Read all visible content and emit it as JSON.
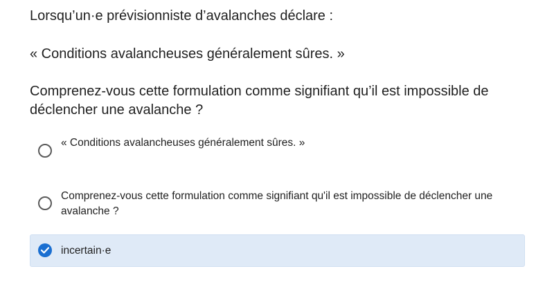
{
  "question": {
    "intro": "Lorsqu’un·e prévisionniste d’avalanches déclare :",
    "quote": "« Conditions avalancheuses généralement sûres. »",
    "ask": "Comprenez-vous cette formulation comme signifiant qu’il est impossible de déclencher une avalanche ?"
  },
  "options": [
    {
      "label": "« Conditions avalancheuses généralement sûres. »",
      "selected": false
    },
    {
      "label": "Comprenez-vous cette formulation comme signifiant qu'il est impossible de déclencher une avalanche ?",
      "selected": false
    },
    {
      "label": "incertain·e",
      "selected": true
    }
  ],
  "colors": {
    "selected_background": "#dfeaf7",
    "selected_radio": "#1a6fd1",
    "text": "#1f1f1f"
  }
}
